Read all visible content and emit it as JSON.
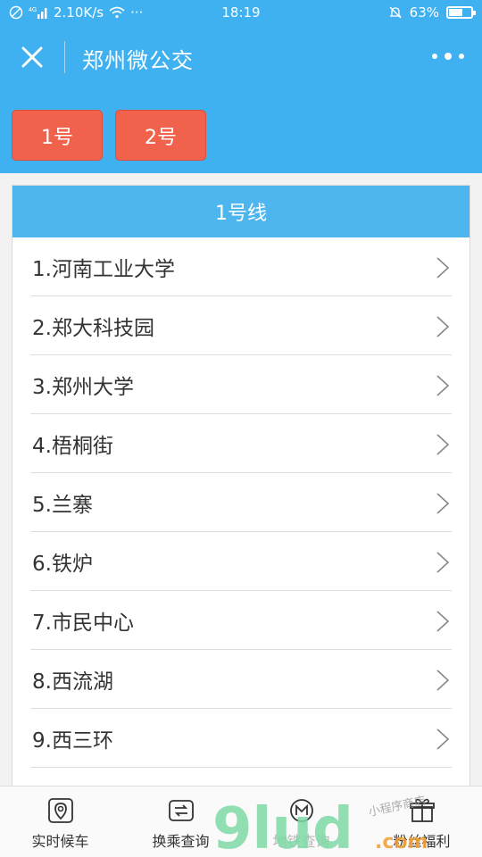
{
  "status_bar": {
    "network_speed": "2.10K/s",
    "signal_label": "4G",
    "more": "···",
    "time": "18:19",
    "battery": "63%",
    "battery_level": 0.63
  },
  "header": {
    "title": "郑州微公交"
  },
  "line_tabs": [
    "1号",
    "2号"
  ],
  "panel": {
    "title": "1号线",
    "stops": [
      "1.河南工业大学",
      "2.郑大科技园",
      "3.郑州大学",
      "4.梧桐街",
      "5.兰寨",
      "6.铁炉",
      "7.市民中心",
      "8.西流湖",
      "9.西三环"
    ]
  },
  "bottom_nav": [
    {
      "label": "实时候车",
      "icon": "map-pin-icon"
    },
    {
      "label": "换乘查询",
      "icon": "transfer-icon"
    },
    {
      "label": "地铁查询",
      "icon": "metro-icon"
    },
    {
      "label": "粉丝福利",
      "icon": "gift-icon"
    }
  ],
  "watermark": {
    "text": "9lud",
    "suffix": ".com",
    "tag": "小程序商店"
  },
  "colors": {
    "header_blue": "#3fb0f0",
    "panel_head_blue": "#4db6ee",
    "tab_orange": "#f0624c"
  }
}
